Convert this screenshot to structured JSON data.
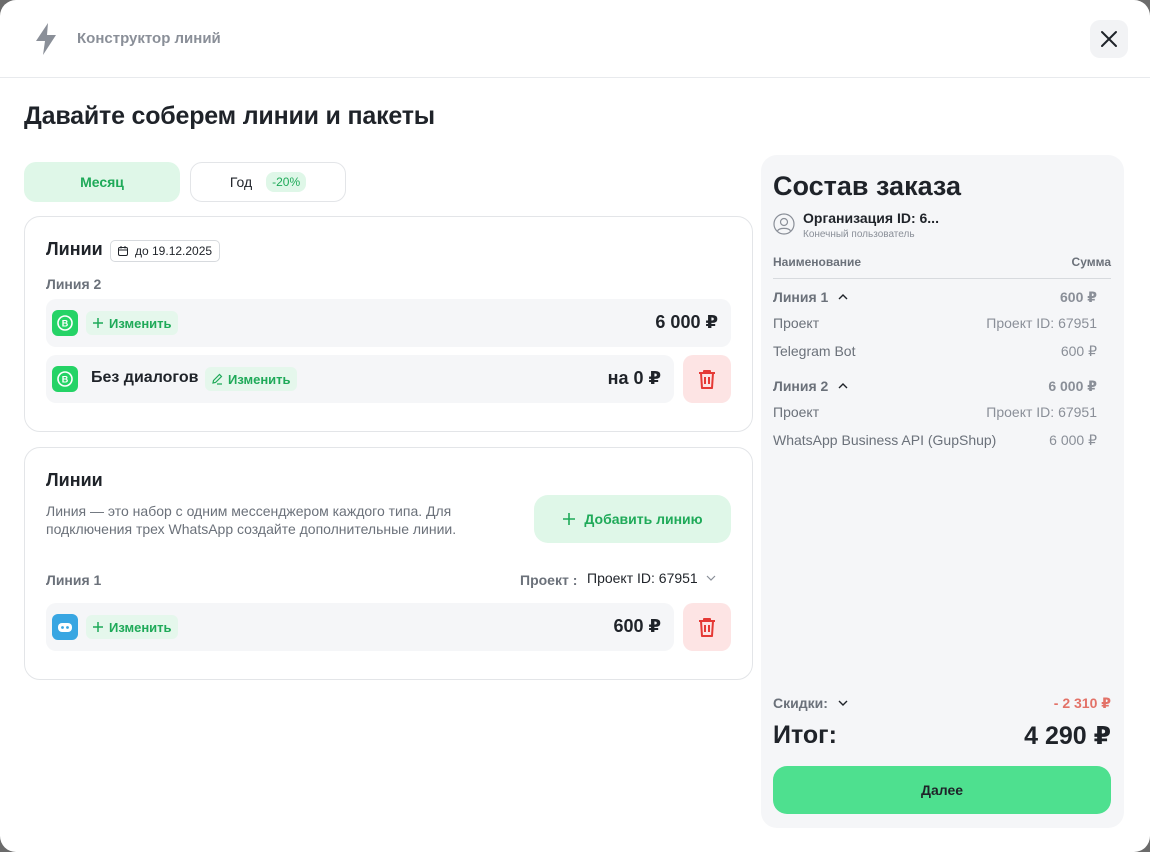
{
  "header": {
    "title": "Конструктор линий",
    "icon": "bolt-icon"
  },
  "heading": "Давайте соберем линии и пакеты",
  "period": {
    "month_label": "Месяц",
    "year_label": "Год",
    "year_discount": "-20%",
    "selected": "month"
  },
  "lines_card": {
    "title": "Линии",
    "until": "до 19.12.2025",
    "line_label": "Линия 2",
    "rows": [
      {
        "icon": "whatsapp-business-icon",
        "change_label": "Изменить",
        "price": "6 000 ₽"
      },
      {
        "icon": "whatsapp-business-icon",
        "name": "Без диалогов",
        "change_label": "Изменить",
        "price": "на 0 ₽"
      }
    ]
  },
  "new_lines_card": {
    "title": "Линии",
    "description": "Линия — это набор с одним мессенджером каждого типа. Для подключения трех WhatsApp создайте дополнительные линии.",
    "add_label": "Добавить линию",
    "line_label": "Линия 1",
    "project_label": "Проект :",
    "project_value": "Проект ID: 67951",
    "row": {
      "icon": "telegram-bot-icon",
      "change_label": "Изменить",
      "price": "600 ₽"
    }
  },
  "summary": {
    "title": "Состав заказа",
    "org_name": "Организация ID: 6...",
    "org_role": "Конечный пользователь",
    "col_name": "Наименование",
    "col_sum": "Сумма",
    "groups": [
      {
        "name": "Линия 1",
        "amount": "600 ₽",
        "items": [
          {
            "label": "Проект",
            "value": "Проект ID: 67951"
          },
          {
            "label": "Telegram Bot",
            "value": "600 ₽"
          }
        ]
      },
      {
        "name": "Линия 2",
        "amount": "6 000 ₽",
        "items": [
          {
            "label": "Проект",
            "value": "Проект ID: 67951"
          },
          {
            "label": "WhatsApp Business API (GupShup)",
            "value": "6 000 ₽"
          }
        ]
      }
    ],
    "discounts_label": "Скидки:",
    "discounts_value": "- 2 310 ₽",
    "total_label": "Итог:",
    "total_value": "4 290 ₽",
    "next_label": "Далее"
  },
  "colors": {
    "accent": "#1faa59",
    "accent_bg": "#dff7e8",
    "button": "#4ee08f",
    "danger": "#e53935",
    "danger_bg": "#fde4e4",
    "discount": "#e37268"
  }
}
